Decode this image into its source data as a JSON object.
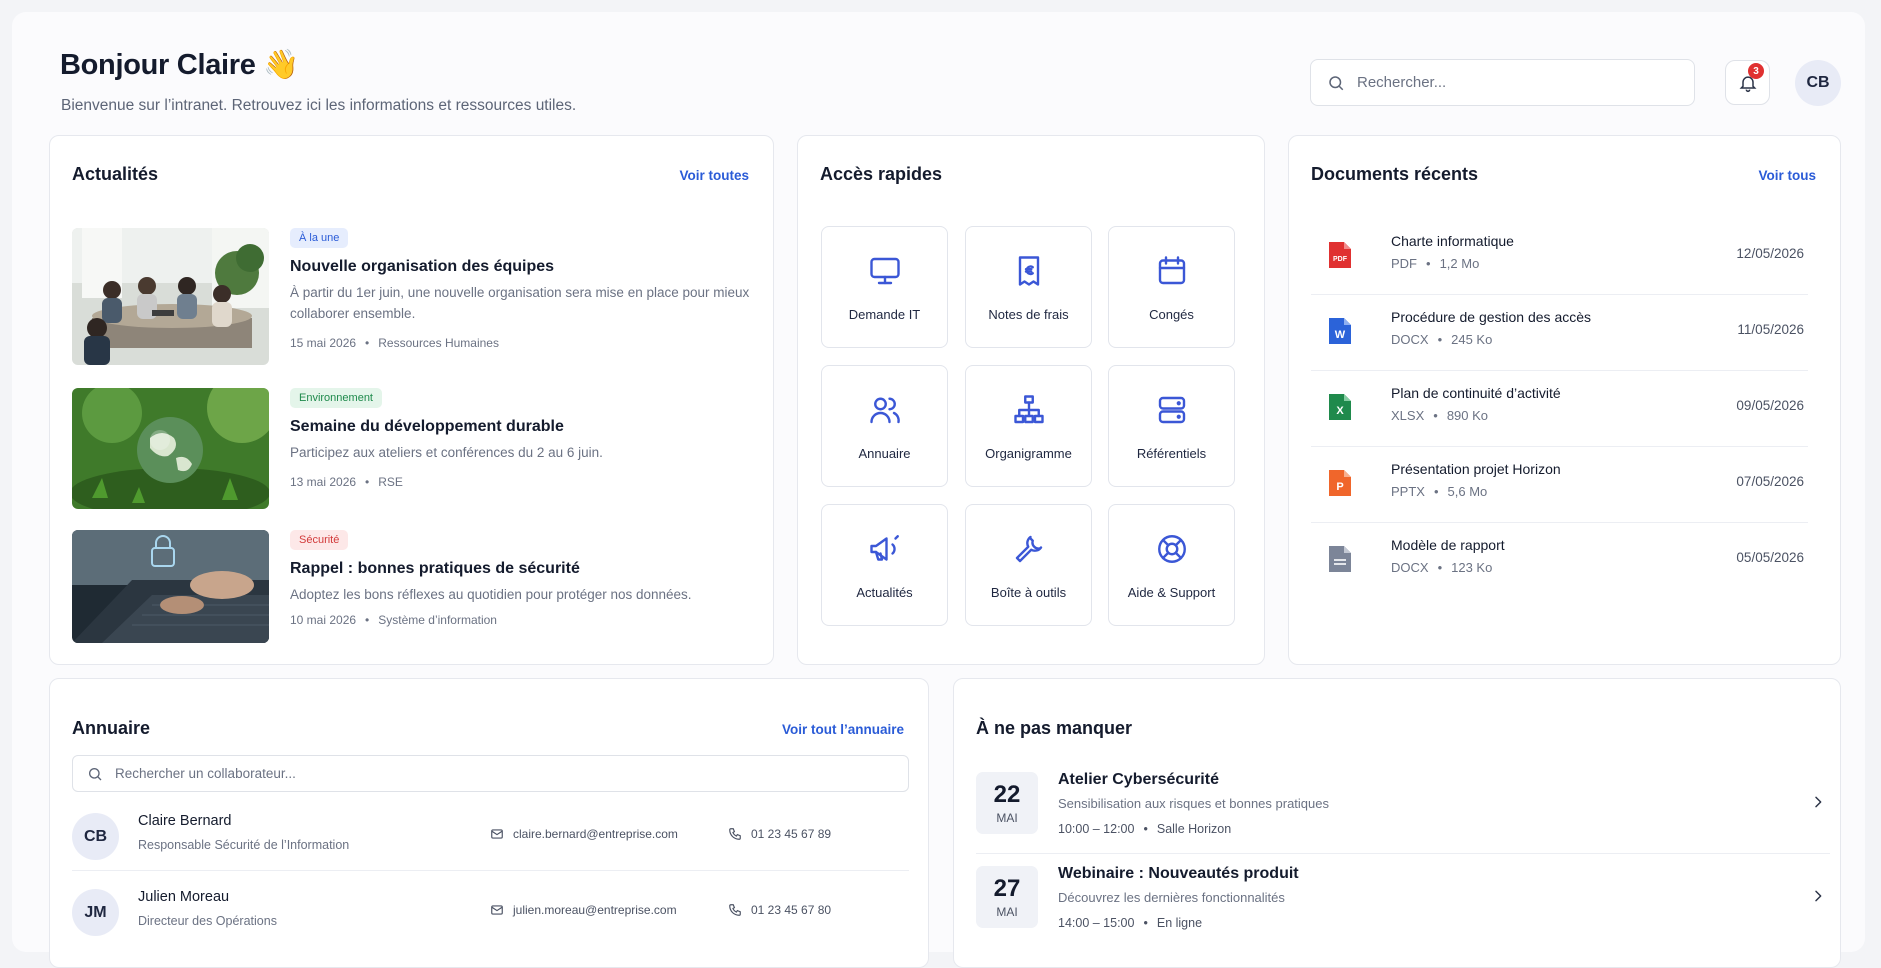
{
  "header": {
    "greeting": "Bonjour Claire 👋",
    "subtitle": "Bienvenue sur l’intranet. Retrouvez ici les informations et ressources utiles.",
    "search_placeholder": "Rechercher...",
    "notification_count": "3",
    "user_initials": "CB"
  },
  "news": {
    "title": "Actualités",
    "link": "Voir toutes",
    "items": [
      {
        "tag": "À la une",
        "title": "Nouvelle organisation des équipes",
        "desc": "À partir du 1er juin, une nouvelle organisation sera mise en place pour mieux collaborer ensemble.",
        "date": "15 mai 2026",
        "category": "Ressources Humaines"
      },
      {
        "tag": "Environnement",
        "title": "Semaine du développement durable",
        "desc": "Participez aux ateliers et conférences du 2 au 6 juin.",
        "date": "13 mai 2026",
        "category": "RSE"
      },
      {
        "tag": "Sécurité",
        "title": "Rappel : bonnes pratiques de sécurité",
        "desc": "Adoptez les bons réflexes au quotidien pour protéger nos données.",
        "date": "10 mai 2026",
        "category": "Système d’information"
      }
    ]
  },
  "quick_access": {
    "title": "Accès rapides",
    "items": [
      {
        "label": "Demande IT",
        "icon": "monitor-icon"
      },
      {
        "label": "Notes de frais",
        "icon": "receipt-euro-icon"
      },
      {
        "label": "Congés",
        "icon": "calendar-icon"
      },
      {
        "label": "Annuaire",
        "icon": "users-icon"
      },
      {
        "label": "Organigramme",
        "icon": "org-chart-icon"
      },
      {
        "label": "Référentiels",
        "icon": "database-icon"
      },
      {
        "label": "Actualités",
        "icon": "megaphone-icon"
      },
      {
        "label": "Boîte à outils",
        "icon": "wrench-icon"
      },
      {
        "label": "Aide & Support",
        "icon": "lifebuoy-icon"
      }
    ]
  },
  "documents": {
    "title": "Documents récents",
    "link": "Voir tous",
    "items": [
      {
        "name": "Charte informatique",
        "type": "PDF",
        "size": "1,2 Mo",
        "date": "12/05/2026",
        "badge": "PDF",
        "color": "#e03131"
      },
      {
        "name": "Procédure de gestion des accès",
        "type": "DOCX",
        "size": "245 Ko",
        "date": "11/05/2026",
        "badge": "W",
        "color": "#2b63d9"
      },
      {
        "name": "Plan de continuité d’activité",
        "type": "XLSX",
        "size": "890 Ko",
        "date": "09/05/2026",
        "badge": "X",
        "color": "#1f8a4c"
      },
      {
        "name": "Présentation projet Horizon",
        "type": "PPTX",
        "size": "5,6 Mo",
        "date": "07/05/2026",
        "badge": "P",
        "color": "#f0662b"
      },
      {
        "name": "Modèle de rapport",
        "type": "DOCX",
        "size": "123 Ko",
        "date": "05/05/2026",
        "badge": "",
        "color": "#7c8598"
      }
    ]
  },
  "directory": {
    "title": "Annuaire",
    "link": "Voir tout l’annuaire",
    "search_placeholder": "Rechercher un collaborateur...",
    "people": [
      {
        "initials": "CB",
        "name": "Claire Bernard",
        "role": "Responsable Sécurité de l’Information",
        "email": "claire.bernard@entreprise.com",
        "phone": "01 23 45 67 89"
      },
      {
        "initials": "JM",
        "name": "Julien Moreau",
        "role": "Directeur des Opérations",
        "email": "julien.moreau@entreprise.com",
        "phone": "01 23 45 67 80"
      }
    ]
  },
  "events": {
    "title": "À ne pas manquer",
    "items": [
      {
        "day": "22",
        "month": "MAI",
        "title": "Atelier Cybersécurité",
        "desc": "Sensibilisation aux risques et bonnes pratiques",
        "time": "10:00 – 12:00",
        "place": "Salle Horizon"
      },
      {
        "day": "27",
        "month": "MAI",
        "title": "Webinaire : Nouveautés produit",
        "desc": "Découvrez les dernières fonctionnalités",
        "time": "14:00 – 15:00",
        "place": "En ligne"
      }
    ]
  },
  "colors": {
    "accent": "#2a5bd7",
    "icon_stroke": "#3b57d6",
    "tag_featured_bg": "#e6edfd",
    "tag_env_bg": "#e4f5ea",
    "tag_security_bg": "#fde8e8"
  }
}
